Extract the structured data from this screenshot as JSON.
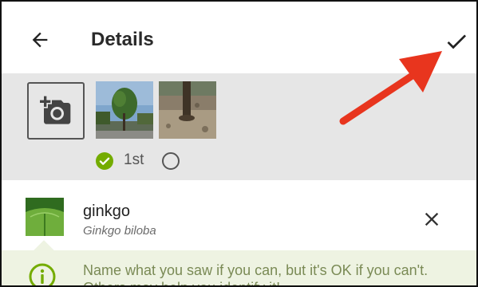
{
  "header": {
    "title": "Details",
    "back_icon": "arrow-back-icon",
    "confirm_icon": "check-icon"
  },
  "photos": {
    "add_photo_icon": "add-photo-camera-icon",
    "first_label": "1st",
    "selected_color": "#74ac00"
  },
  "taxon": {
    "common_name": "ginkgo",
    "scientific_name": "Ginkgo biloba",
    "clear_icon": "close-icon"
  },
  "info": {
    "icon": "info-icon",
    "message": "Name what you saw if you can, but it's OK if you can't. Others may help you identify it!",
    "accent_color": "#74ac00"
  },
  "annotation": {
    "arrow_color": "#e8351e"
  }
}
